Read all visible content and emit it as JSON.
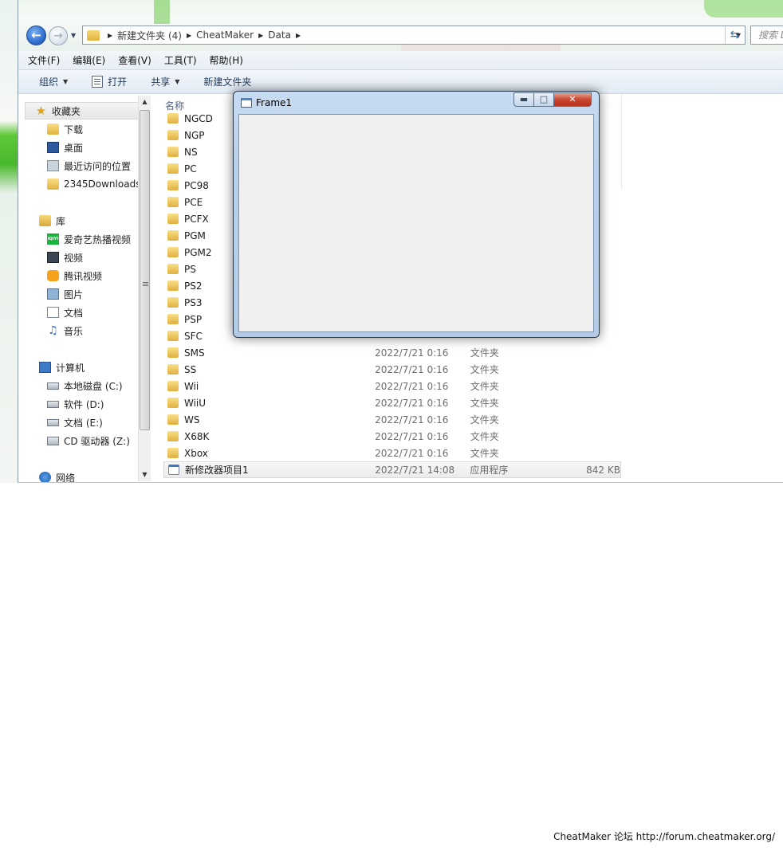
{
  "address": {
    "crumbs": [
      "新建文件夹 (4)",
      "CheatMaker",
      "Data"
    ],
    "search_placeholder": "搜索 D"
  },
  "menubar": [
    "文件(F)",
    "编辑(E)",
    "查看(V)",
    "工具(T)",
    "帮助(H)"
  ],
  "toolbar": {
    "organize": "组织",
    "open": "打开",
    "share": "共享",
    "new_folder": "新建文件夹"
  },
  "navpane": {
    "favorites": {
      "label": "收藏夹",
      "items": [
        "下载",
        "桌面",
        "最近访问的位置",
        "2345Downloads"
      ]
    },
    "libraries": {
      "label": "库",
      "items": [
        "爱奇艺热播视频",
        "视频",
        "腾讯视频",
        "图片",
        "文档",
        "音乐"
      ]
    },
    "computer": {
      "label": "计算机",
      "items": [
        "本地磁盘 (C:)",
        "软件 (D:)",
        "文档 (E:)",
        "CD 驱动器 (Z:)"
      ]
    },
    "network": {
      "label": "网络"
    }
  },
  "filelist": {
    "col_name": "名称",
    "rows": [
      {
        "name": "NGCD",
        "date": "",
        "type": "",
        "size": ""
      },
      {
        "name": "NGP",
        "date": "",
        "type": "",
        "size": ""
      },
      {
        "name": "NS",
        "date": "",
        "type": "",
        "size": ""
      },
      {
        "name": "PC",
        "date": "",
        "type": "",
        "size": ""
      },
      {
        "name": "PC98",
        "date": "",
        "type": "",
        "size": ""
      },
      {
        "name": "PCE",
        "date": "",
        "type": "",
        "size": ""
      },
      {
        "name": "PCFX",
        "date": "",
        "type": "",
        "size": ""
      },
      {
        "name": "PGM",
        "date": "",
        "type": "",
        "size": ""
      },
      {
        "name": "PGM2",
        "date": "",
        "type": "",
        "size": ""
      },
      {
        "name": "PS",
        "date": "",
        "type": "",
        "size": ""
      },
      {
        "name": "PS2",
        "date": "",
        "type": "",
        "size": ""
      },
      {
        "name": "PS3",
        "date": "",
        "type": "",
        "size": ""
      },
      {
        "name": "PSP",
        "date": "",
        "type": "",
        "size": ""
      },
      {
        "name": "SFC",
        "date": "",
        "type": "",
        "size": ""
      },
      {
        "name": "SMS",
        "date": "2022/7/21 0:16",
        "type": "文件夹",
        "size": ""
      },
      {
        "name": "SS",
        "date": "2022/7/21 0:16",
        "type": "文件夹",
        "size": ""
      },
      {
        "name": "Wii",
        "date": "2022/7/21 0:16",
        "type": "文件夹",
        "size": ""
      },
      {
        "name": "WiiU",
        "date": "2022/7/21 0:16",
        "type": "文件夹",
        "size": ""
      },
      {
        "name": "WS",
        "date": "2022/7/21 0:16",
        "type": "文件夹",
        "size": ""
      },
      {
        "name": "X68K",
        "date": "2022/7/21 0:16",
        "type": "文件夹",
        "size": ""
      },
      {
        "name": "Xbox",
        "date": "2022/7/21 0:16",
        "type": "文件夹",
        "size": ""
      },
      {
        "name": "新修改器项目1",
        "date": "2022/7/21 14:08",
        "type": "应用程序",
        "size": "842 KB"
      }
    ]
  },
  "frame": {
    "title": "Frame1"
  },
  "footer": "CheatMaker 论坛 http://forum.cheatmaker.org/"
}
